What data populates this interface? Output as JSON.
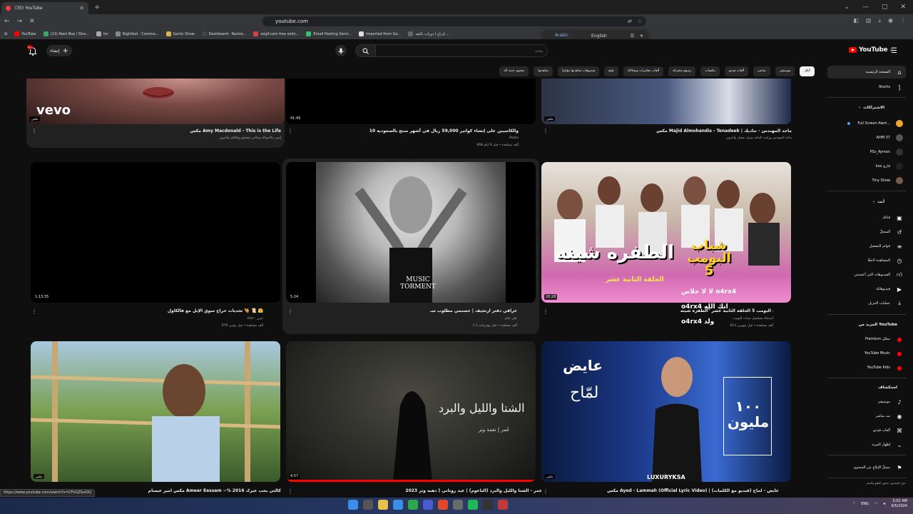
{
  "browser": {
    "tab_title": "(35) YouTube",
    "address": "youtube.com",
    "bookmarks": [
      "YouTube",
      "(13) Alert Box / Stre...",
      "fxr",
      "Nightbot - Comma...",
      "Gartic Show",
      "Dashboard - Restre...",
      "ezgif.com free onlin...",
      "Email Hosting Servi...",
      "Imported from Go...",
      "إدراج | دورات بالثقة ..."
    ],
    "translate_source": "Arabic",
    "translate_target": "English",
    "status_url": "https://www.youtube.com/watch?v=CFhGZSuIOQ"
  },
  "masthead": {
    "create_label": "إنشاء",
    "notif_count": "9+",
    "search_placeholder": "بحث",
    "logo_text": "YouTube",
    "logo_region": "SA"
  },
  "chips": [
    "الكل",
    "موسيقى",
    "مباشر",
    "ألعاب فيديو",
    "مكسات",
    "رسوم متحركة",
    "ألعاب مغامرات ومحاكاة",
    "طبخ",
    "فيديوهات شاهدتها مؤخرًا",
    "شاهدتها",
    "محتوى جديد لك"
  ],
  "sidebar": {
    "home": "الصفحة الرئيسية",
    "shorts": "Shorts",
    "subs_head": "الاشتراكات",
    "subs": [
      {
        "name": "Full Screen Alert...",
        "color": "#f4a62a",
        "live": true
      },
      {
        "name": "AHM 37",
        "color": "#555555",
        "live": false
      },
      {
        "name": "PSz_Ayman",
        "color": "#333333",
        "live": false
      },
      {
        "name": "ksa قارئ",
        "color": "#222222",
        "live": false
      },
      {
        "name": "Tiny Show",
        "color": "#7a5b4a",
        "live": false
      }
    ],
    "you_head": "أنت",
    "you_items": [
      "قناتك",
      "السجلّ",
      "قوائم التشغيل",
      "المشاهدة لاحقًا",
      "الفيديوهات التي أعجبتني",
      "فيديوهاتك",
      "عمليات التنزيل"
    ],
    "more_head": "المزيد من YouTube",
    "more_items": [
      "Premium سجّل",
      "YouTube Music",
      "YouTube Kids"
    ],
    "explore_head": "استكشاف",
    "explore_items": [
      "موسيقى",
      "بث مباشر",
      "ألعاب فيديو",
      "إظهار المزيد"
    ],
    "report": "سجلّ الإبلاغ عن المحتوى",
    "footer": "حول المحتوى حقوق الطبع والنشر"
  },
  "videos": [
    {
      "title": "مكس Amy Macdonald - This is the Life",
      "meta1": "إيمي ماكدونالد وديلاني فيجيليو ويالكاي وآخرون",
      "meta2": "",
      "duration": "",
      "badge": "مكس",
      "bg": "#3a2220"
    },
    {
      "title": "10 والكاسبين على إنشاء كواتير 59,000 ريال في أشهر منتج بالسعودية",
      "meta1": "Peaks",
      "meta2": "668 ألف مشاهدة • قبل 6 أيام",
      "duration": "41:45",
      "badge": "",
      "bg": "#000000"
    },
    {
      "title": "مكس Majid Almohandis - Tenadeek | ماجد المهندس - تناديك",
      "meta1": "ماجد المهندس وراشد الماجد ونبيل شعيل وآخرون",
      "meta2": "",
      "duration": "",
      "badge": "مكس",
      "bg": "#33405a"
    },
    {
      "title": "تحديات حراج سوق الإبل مع فالكاول 🐪 📜 🤗",
      "meta1": "Aziz - عزيز",
      "meta2": "679 ألف مشاهدة • قبل يومين",
      "duration": "1:13:35",
      "badge": "",
      "bg": "#000000"
    },
    {
      "title": "عراقي دفتر ارتجيف | حسنمي مطلوب سـ",
      "meta1": "علي غنام",
      "meta2": "1.1 ألف مشاهدة • قبل يوم واحد",
      "duration": "5:24",
      "badge": "",
      "bg": "#1a1a1a"
    },
    {
      "title": "مسلسل شباب البومب 5 الحلقة الثانية عشر \"الطفره شينه\"",
      "meta1": "أصدقاء مسلسل شباب البومب",
      "meta2": "613 ألف مشاهدة • قبل شهرين",
      "duration": "20:28",
      "badge": "",
      "bg": "#8a5a8a"
    },
    {
      "title": "مكس امير عيسام Ameer Eessam ~% كالتي يحب عيرك 2016",
      "meta1": "",
      "meta2": "",
      "duration": "",
      "badge": "مكس",
      "bg": "#3c5a2c"
    },
    {
      "title": "عمر - الشتا والليل والبرد (الناعوم) | عبد روتاني ( ذهبة وتر 2023",
      "meta1": "",
      "meta2": "",
      "duration": "4:57",
      "badge": "",
      "bg": "#2a2a26"
    },
    {
      "title": "مكس Ayed - Lammah (Official Lyric Video) | عايض - لماح (فيديو مع الكلمات)",
      "meta1": "",
      "meta2": "",
      "duration": "",
      "badge": "مكس",
      "bg": "#1d3b8c"
    }
  ],
  "thumb_text": {
    "vevo": "vevo",
    "music_torment": "MUSIC TORMENT",
    "show_title": "الطفره شينه",
    "show_logo": "شباب البومب 5",
    "show_ep": "الحلقة الثانية عشر",
    "ov_line1": "لا لا خلاص o4rx4",
    "ov_line2": "o4rx4 انك الله",
    "ov_line3": "o4rx4 ولد",
    "winter": "الشتا والليل والبرد",
    "winter_sub": "عُمر | نغمة وتر",
    "lammah_top": "عايض",
    "lammah_word": "لمّاح",
    "million": "١٠٠ مليون",
    "luxury": "LUXURYKSA"
  },
  "taskbar": {
    "lang": "ENG",
    "time": "5:02 AM",
    "date": "6/5/2024"
  },
  "colors": {
    "bg": "#0f0f0f",
    "accent_red": "#ff0000",
    "chip_bg": "#272727",
    "link_blue": "#3ea6ff"
  }
}
